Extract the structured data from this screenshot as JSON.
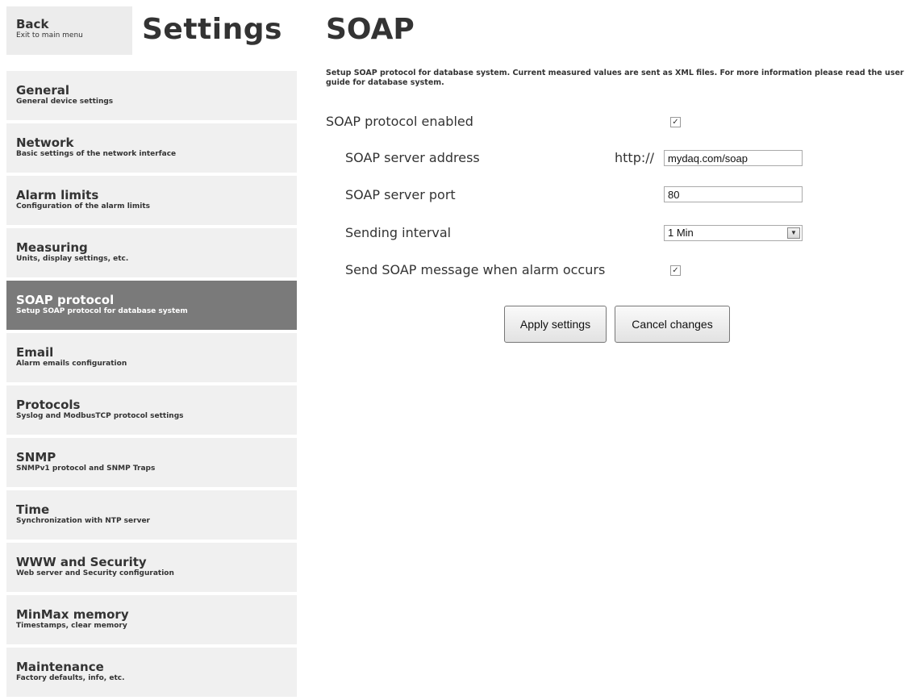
{
  "back": {
    "title": "Back",
    "subtitle": "Exit to main menu"
  },
  "sidebar_title": "Settings",
  "nav": [
    {
      "title": "General",
      "subtitle": "General device settings"
    },
    {
      "title": "Network",
      "subtitle": "Basic settings of the network interface"
    },
    {
      "title": "Alarm limits",
      "subtitle": "Configuration of the alarm limits"
    },
    {
      "title": "Measuring",
      "subtitle": "Units, display settings, etc."
    },
    {
      "title": "SOAP protocol",
      "subtitle": "Setup SOAP protocol for database system",
      "active": true
    },
    {
      "title": "Email",
      "subtitle": "Alarm emails configuration"
    },
    {
      "title": "Protocols",
      "subtitle": "Syslog and ModbusTCP protocol settings"
    },
    {
      "title": "SNMP",
      "subtitle": "SNMPv1 protocol and SNMP Traps"
    },
    {
      "title": "Time",
      "subtitle": "Synchronization with NTP server"
    },
    {
      "title": "WWW and Security",
      "subtitle": "Web server and Security configuration"
    },
    {
      "title": "MinMax memory",
      "subtitle": "Timestamps, clear memory"
    },
    {
      "title": "Maintenance",
      "subtitle": "Factory defaults, info, etc."
    }
  ],
  "main": {
    "title": "SOAP",
    "description": "Setup SOAP protocol for database system. Current measured values are sent as XML files. For more information please read the user guide for database system.",
    "enabled_label": "SOAP protocol enabled",
    "enabled_checked": true,
    "server_address_label": "SOAP server address",
    "server_address_prefix": "http://",
    "server_address_value": "mydaq.com/soap",
    "server_port_label": "SOAP server port",
    "server_port_value": "80",
    "interval_label": "Sending interval",
    "interval_value": "1 Min",
    "alarm_label": "Send SOAP message when alarm occurs",
    "alarm_checked": true,
    "apply_label": "Apply settings",
    "cancel_label": "Cancel changes"
  },
  "colors": {
    "active_nav": "#7a7a7a",
    "nav_bg": "#f0f0f0"
  }
}
